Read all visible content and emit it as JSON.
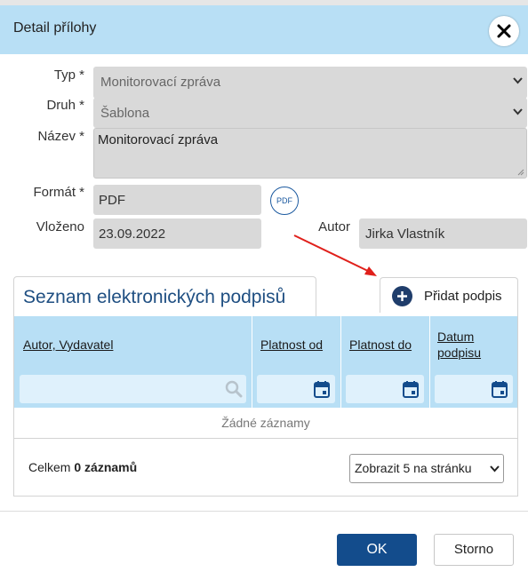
{
  "dialog": {
    "title": "Detail přílohy",
    "close_icon": "close-icon"
  },
  "form": {
    "type_label": "Typ *",
    "type_value": "Monitorovací zpráva",
    "kind_label": "Druh *",
    "kind_value": "Šablona",
    "name_label": "Název *",
    "name_value": "Monitorovací zpráva",
    "format_label": "Formát *",
    "format_value": "PDF",
    "pdf_icon_text": "PDF",
    "inserted_label": "Vloženo",
    "inserted_value": "23.09.2022",
    "author_label": "Autor",
    "author_value": "Jirka Vlastník"
  },
  "signatures": {
    "tab_label": "Seznam elektronických podpisů",
    "add_label": "Přidat podpis",
    "columns": [
      "Autor, Vydavatel",
      "Platnost od",
      "Platnost do",
      "Datum",
      "podpisu"
    ],
    "empty_text": "Žádné záznamy",
    "total_prefix": "Celkem",
    "total_count": "0 záznamů",
    "page_size": "Zobrazit 5 na stránku"
  },
  "footer": {
    "ok_label": "OK",
    "cancel_label": "Storno"
  },
  "colors": {
    "header_bg": "#b8dff5",
    "primary": "#134c8c",
    "annotation_arrow": "#e0201b"
  }
}
